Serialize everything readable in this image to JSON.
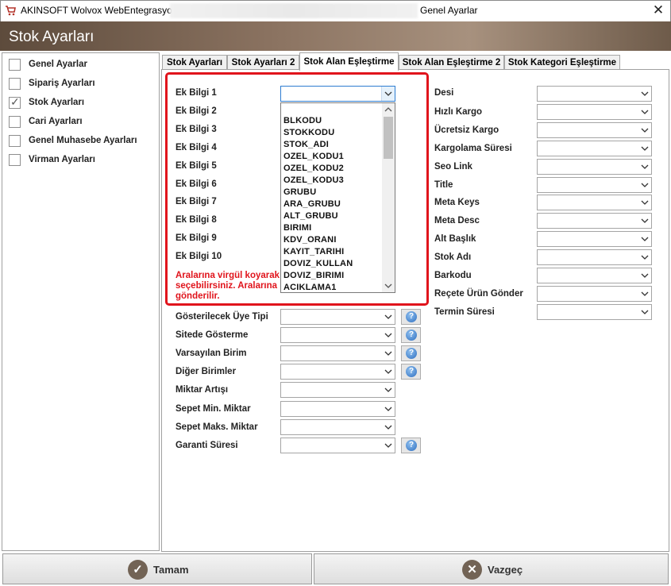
{
  "window": {
    "title_left": "AKINSOFT Wolvox WebEntegrasyon",
    "title_right": "Genel Ayarlar",
    "close_glyph": "✕"
  },
  "header": {
    "title": "Stok Ayarları"
  },
  "sidebar": {
    "items": [
      {
        "label": "Genel Ayarlar",
        "checked": false
      },
      {
        "label": "Sipariş Ayarları",
        "checked": false
      },
      {
        "label": "Stok Ayarları",
        "checked": true
      },
      {
        "label": "Cari Ayarları",
        "checked": false
      },
      {
        "label": "Genel Muhasebe Ayarları",
        "checked": false
      },
      {
        "label": "Virman Ayarları",
        "checked": false
      }
    ]
  },
  "tabs": [
    {
      "label": "Stok Ayarları"
    },
    {
      "label": "Stok Ayarları 2"
    },
    {
      "label": "Stok Alan Eşleştirme",
      "active": true
    },
    {
      "label": "Stok Alan Eşleştirme 2"
    },
    {
      "label": "Stok Kategori Eşleştirme"
    }
  ],
  "left_fields": [
    {
      "label": "Ek Bilgi 1"
    },
    {
      "label": "Ek Bilgi 2"
    },
    {
      "label": "Ek Bilgi 3"
    },
    {
      "label": "Ek Bilgi 4"
    },
    {
      "label": "Ek Bilgi 5"
    },
    {
      "label": "Ek Bilgi 6"
    },
    {
      "label": "Ek Bilgi 7"
    },
    {
      "label": "Ek Bilgi 8"
    },
    {
      "label": "Ek Bilgi 9"
    },
    {
      "label": "Ek Bilgi 10"
    }
  ],
  "info_text": {
    "line1": "Aralarına virgül koyarak",
    "line2": "seçebilirsiniz. Aralarına",
    "line3": "gönderilir."
  },
  "dropdown": {
    "options": [
      "BLKODU",
      "STOKKODU",
      "STOK_ADI",
      "OZEL_KODU1",
      "OZEL_KODU2",
      "OZEL_KODU3",
      "GRUBU",
      "ARA_GRUBU",
      "ALT_GRUBU",
      "BIRIMI",
      "KDV_ORANI",
      "KAYIT_TARIHI",
      "DOVIZ_KULLAN",
      "DOVIZ_BIRIMI",
      "ACIKLAMA1"
    ]
  },
  "lower_fields": [
    {
      "label": "Gösterilecek Üye Tipi",
      "help": true
    },
    {
      "label": "Sitede Gösterme",
      "help": true
    },
    {
      "label": "Varsayılan Birim",
      "help": true
    },
    {
      "label": "Diğer Birimler",
      "help": true
    },
    {
      "label": "Miktar Artışı",
      "help": false
    },
    {
      "label": "Sepet Min. Miktar",
      "help": false
    },
    {
      "label": "Sepet Maks. Miktar",
      "help": false
    },
    {
      "label": "Garanti Süresi",
      "help": true
    }
  ],
  "right_fields": [
    {
      "label": "Desi"
    },
    {
      "label": "Hızlı Kargo"
    },
    {
      "label": "Ücretsiz Kargo"
    },
    {
      "label": "Kargolama Süresi"
    },
    {
      "label": "Seo Link"
    },
    {
      "label": "Title"
    },
    {
      "label": "Meta Keys"
    },
    {
      "label": "Meta Desc"
    },
    {
      "label": "Alt Başlık"
    },
    {
      "label": "Stok Adı"
    },
    {
      "label": "Barkodu"
    },
    {
      "label": "Reçete Ürün Gönder"
    },
    {
      "label": "Termin Süresi"
    }
  ],
  "buttons": {
    "ok": "Tamam",
    "cancel": "Vazgeç"
  },
  "colors": {
    "accent": "#e0141c",
    "header_brown": "#8a7260",
    "button_icon": "#726355"
  }
}
